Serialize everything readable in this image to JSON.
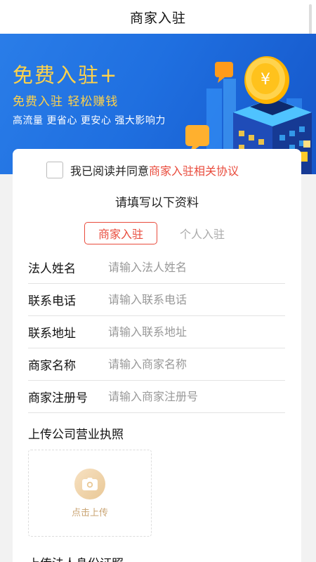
{
  "header": {
    "title": "商家入驻"
  },
  "banner": {
    "headline": "免费入驻+",
    "subtitle": "免费入驻  轻松赚钱",
    "tagline": "高流量  更省心  更安心  强大影响力",
    "coin_symbol": "¥"
  },
  "agreement": {
    "prefix": "我已阅读并同意",
    "link": "商家入驻相关协议",
    "checked": false
  },
  "form": {
    "title": "请填写以下资料",
    "tabs": [
      {
        "label": "商家入驻",
        "active": true
      },
      {
        "label": "个人入驻",
        "active": false
      }
    ],
    "fields": [
      {
        "label": "法人姓名",
        "placeholder": "请输入法人姓名"
      },
      {
        "label": "联系电话",
        "placeholder": "请输入联系电话"
      },
      {
        "label": "联系地址",
        "placeholder": "请输入联系地址"
      },
      {
        "label": "商家名称",
        "placeholder": "请输入商家名称"
      },
      {
        "label": "商家注册号",
        "placeholder": "请输入商家注册号"
      }
    ]
  },
  "upload": {
    "license_title": "上传公司营业执照",
    "button_label": "点击上传",
    "idcard_title": "上传法人身份证照"
  },
  "colors": {
    "accent": "#e94b3c",
    "banner_blue": "#1f6fe0",
    "gold": "#ffd24a"
  }
}
